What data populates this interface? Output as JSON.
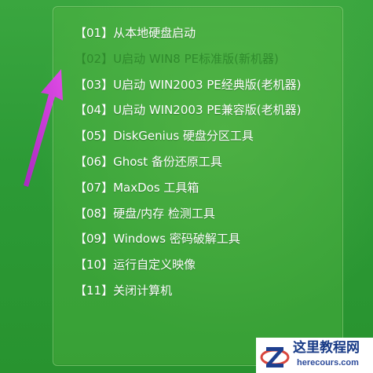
{
  "boot_menu": {
    "items": [
      {
        "label": "【01】从本地硬盘启动",
        "selected": false
      },
      {
        "label": "【02】U启动 WIN8 PE标准版(新机器)",
        "selected": true
      },
      {
        "label": "【03】U启动 WIN2003 PE经典版(老机器)",
        "selected": false
      },
      {
        "label": "【04】U启动 WIN2003 PE兼容版(老机器)",
        "selected": false
      },
      {
        "label": "【05】DiskGenius 硬盘分区工具",
        "selected": false
      },
      {
        "label": "【06】Ghost 备份还原工具",
        "selected": false
      },
      {
        "label": "【07】MaxDos 工具箱",
        "selected": false
      },
      {
        "label": "【08】硬盘/内存 检测工具",
        "selected": false
      },
      {
        "label": "【09】Windows 密码破解工具",
        "selected": false
      },
      {
        "label": "【10】运行自定义映像",
        "selected": false
      },
      {
        "label": "【11】关闭计算机",
        "selected": false
      }
    ]
  },
  "annotation": {
    "arrow_color": "#c53ad6",
    "highlight_border_color": "#d9473e"
  },
  "watermark": {
    "title": "这里教程网",
    "url": "herecours.com",
    "logo_letter": "Z"
  },
  "colors": {
    "background": "#2d9b3a",
    "item_text": "#ffffff",
    "selected_text": "#2f8a2c"
  }
}
